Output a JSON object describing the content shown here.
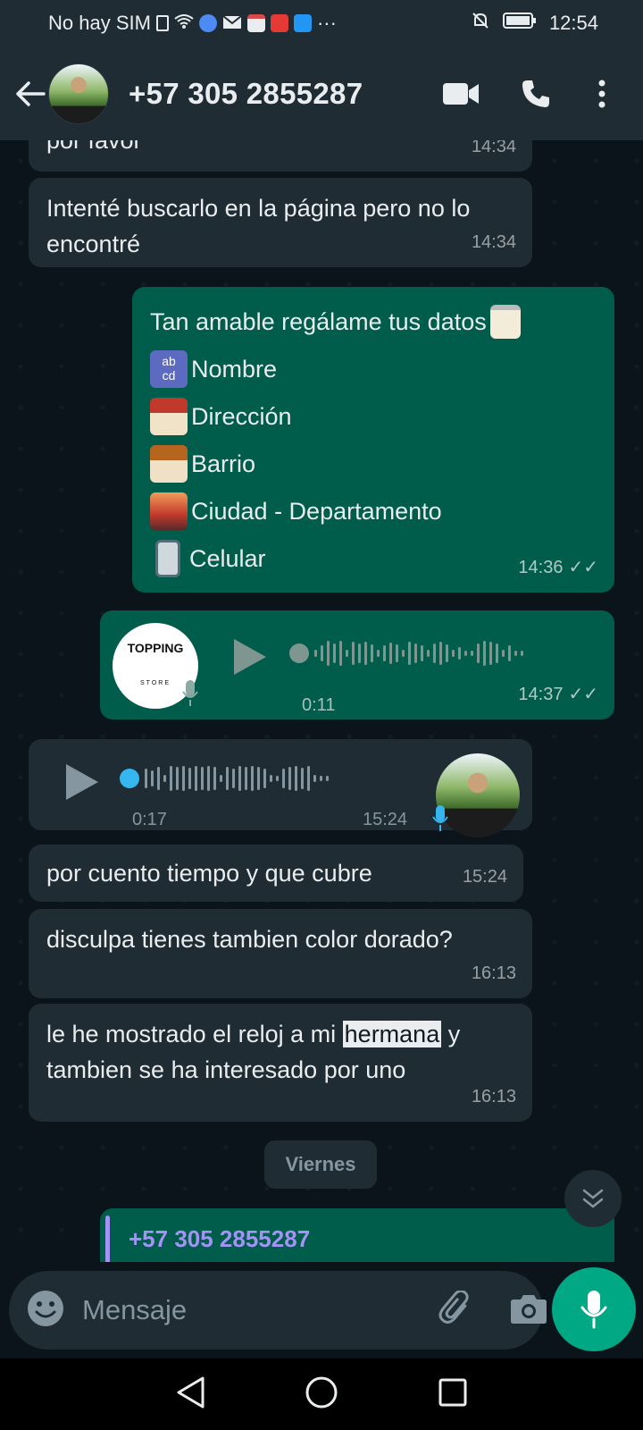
{
  "status_bar": {
    "carrier": "No hay SIM",
    "notification_icons": [
      "sim-icon",
      "wifi-icon",
      "chrome-icon",
      "mail-icon",
      "store-icon",
      "mail-app-icon",
      "search-app-icon"
    ],
    "more": "···",
    "time": "12:54"
  },
  "header": {
    "contact": "+57 305 2855287",
    "icons": [
      "back-arrow-icon",
      "video-call-icon",
      "phone-icon",
      "more-vert-icon"
    ]
  },
  "messages": [
    {
      "type": "text",
      "direction": "in",
      "text": "por favor",
      "time": "14:34"
    },
    {
      "type": "text",
      "direction": "in",
      "text": "Intenté buscarlo en la página pero no lo encontré",
      "time": "14:34"
    },
    {
      "type": "list",
      "direction": "out",
      "time": "14:36",
      "status": "read",
      "title": "Tan amable regálame tus datos",
      "items": [
        "Nombre",
        "Dirección",
        "Barrio",
        "Ciudad - Departamento",
        "Celular"
      ]
    },
    {
      "type": "voice",
      "direction": "out",
      "duration": "0:11",
      "time": "14:37",
      "status": "read",
      "avatar_text": "TOPPING",
      "avatar_subtext": "STORE"
    },
    {
      "type": "voice",
      "direction": "in",
      "duration": "0:17",
      "time": "15:24"
    },
    {
      "type": "text",
      "direction": "in",
      "text": "por cuento tiempo y que cubre",
      "time": "15:24"
    },
    {
      "type": "text",
      "direction": "in",
      "text": "disculpa tienes tambien color dorado?",
      "time": "16:13"
    },
    {
      "type": "text",
      "direction": "in",
      "text_before": "le he mostrado el reloj a mi ",
      "highlight": "hermana",
      "text_after": " y tambien se ha interesado por uno",
      "time": "16:13"
    }
  ],
  "date_chip": "Viernes",
  "partial_message": "+57 305 2855287",
  "input": {
    "placeholder": "Mensaje"
  },
  "colors": {
    "incoming": "#1f2c34",
    "outgoing": "#005c4b",
    "accent": "#00a884",
    "background": "#0b141a"
  }
}
